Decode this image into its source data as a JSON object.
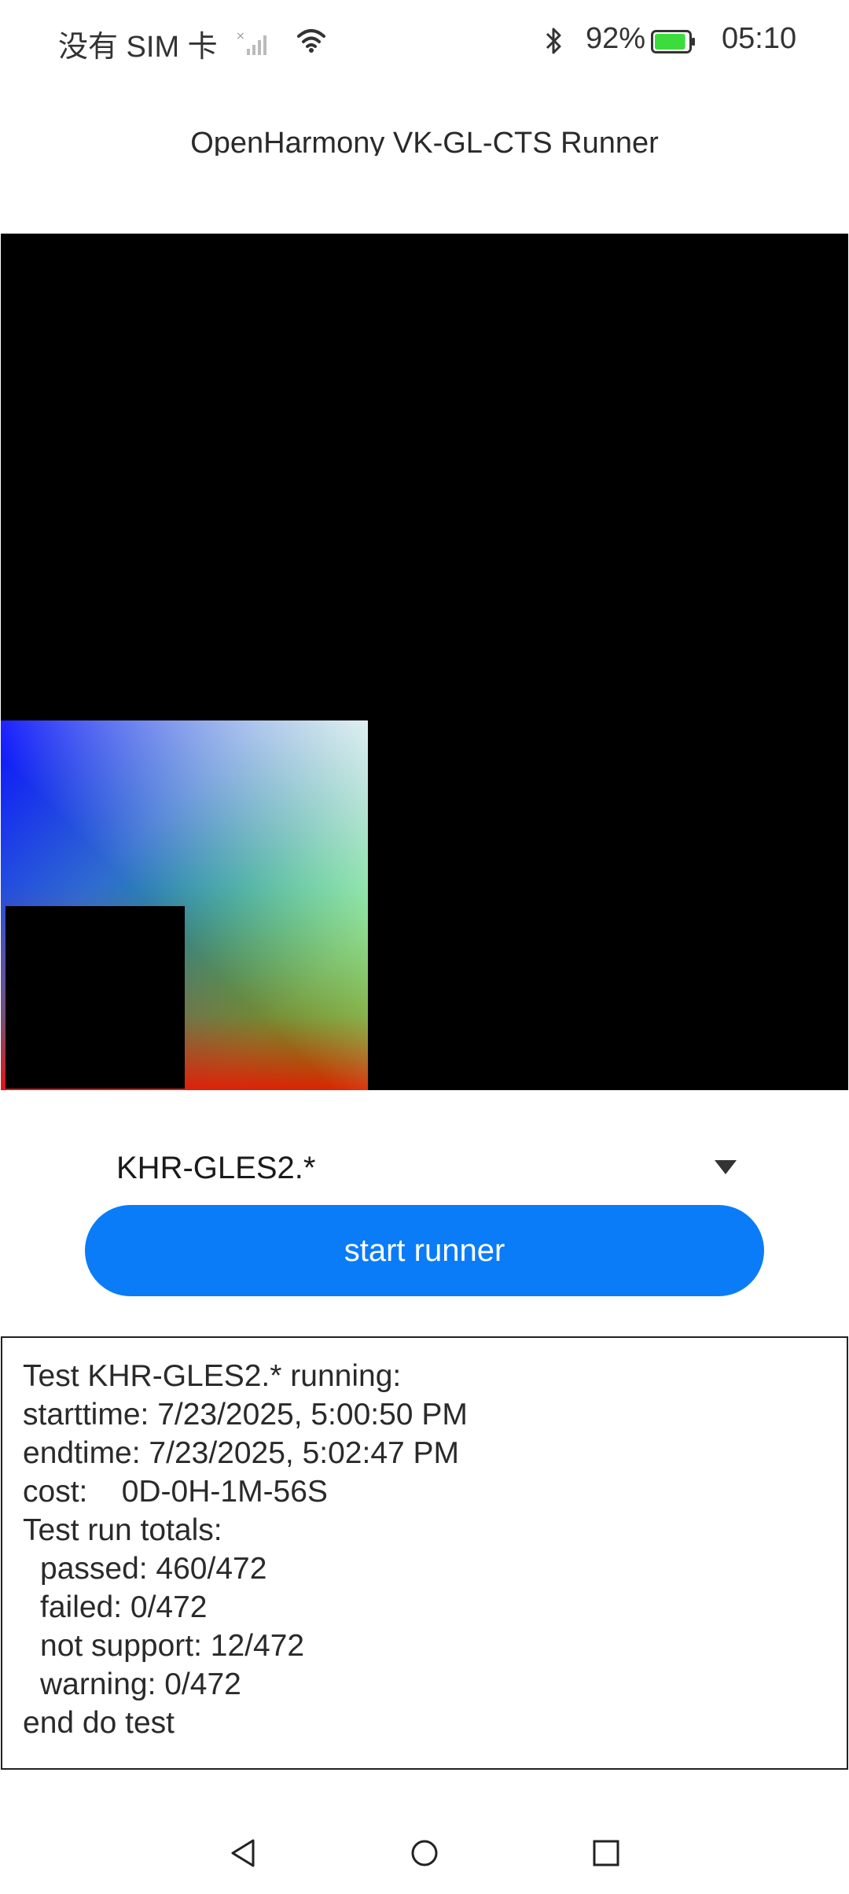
{
  "status_bar": {
    "carrier": "没有 SIM 卡",
    "battery_percent": "92%",
    "battery_level": 0.92,
    "time": "05:10",
    "icons": [
      "signal-icon",
      "wifi-icon",
      "bluetooth-icon",
      "battery-icon"
    ]
  },
  "app": {
    "title": "OpenHarmony VK-GL-CTS Runner"
  },
  "selector": {
    "value": "KHR-GLES2.*"
  },
  "actions": {
    "start_label": "start runner"
  },
  "log": {
    "lines": [
      "Test KHR-GLES2.* running:",
      "starttime: 7/23/2025, 5:00:50 PM",
      "endtime: 7/23/2025, 5:02:47 PM",
      "cost:    0D-0H-1M-56S",
      "Test run totals:",
      "passed: 460/472",
      "failed: 0/472",
      "not support: 12/472",
      "warning: 0/472",
      "end do test"
    ]
  },
  "colors": {
    "accent": "#0a7cf8",
    "battery": "#3ddc3d"
  },
  "nav": {
    "icons": [
      "back-icon",
      "home-icon",
      "recent-apps-icon"
    ]
  }
}
